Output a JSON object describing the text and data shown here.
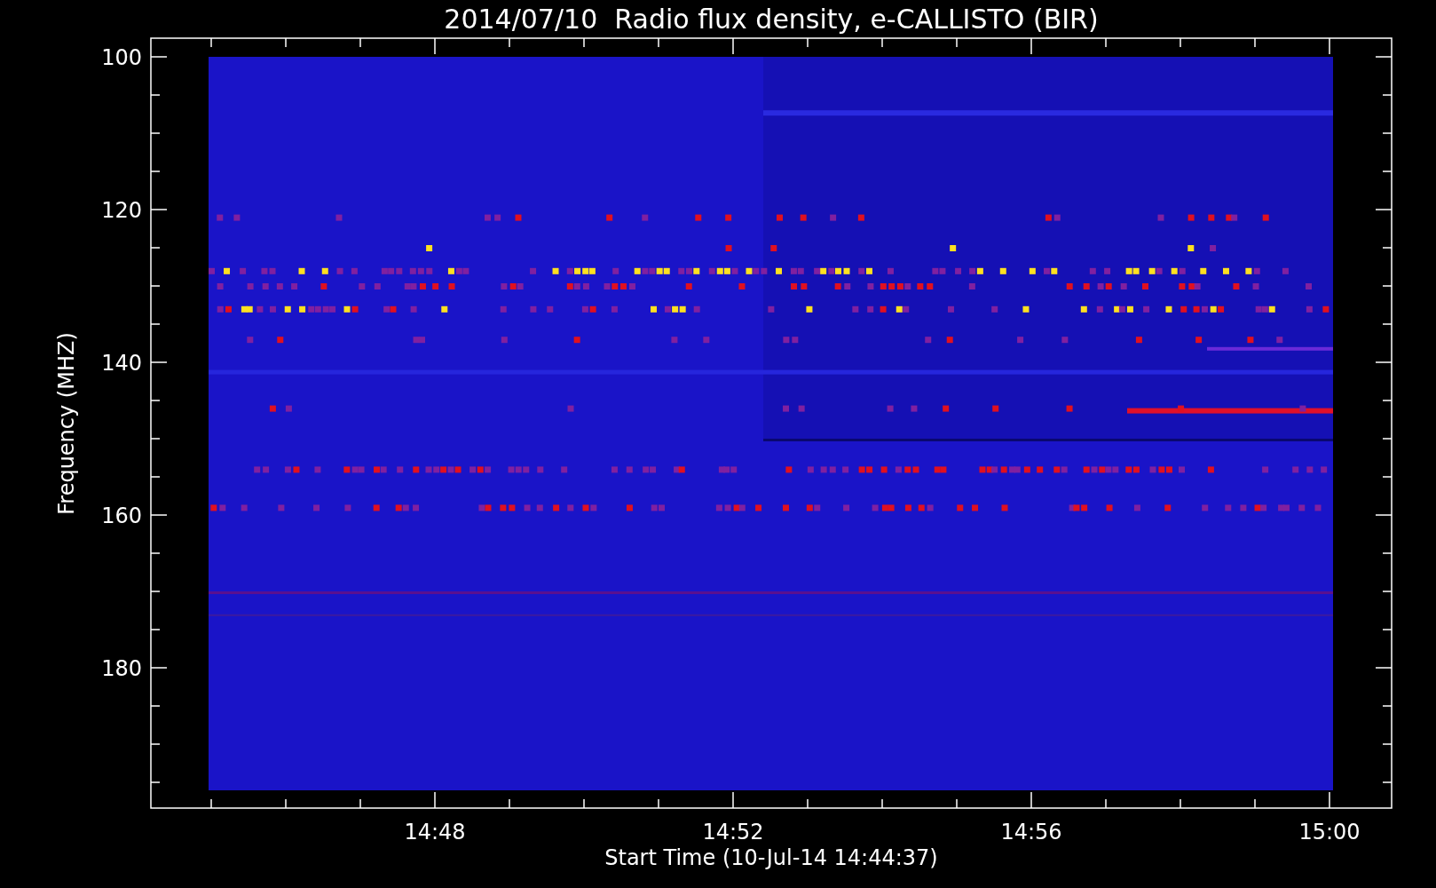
{
  "title": "2014/07/10  Radio flux density, e-CALLISTO (BIR)",
  "y_axis": {
    "label": "Frequency (MHZ)",
    "ticks": [
      "100",
      "120",
      "140",
      "160",
      "180"
    ]
  },
  "x_axis": {
    "label": "Start Time (10-Jul-14 14:44:37)",
    "ticks": [
      "14:48",
      "14:52",
      "14:56",
      "15:00"
    ]
  }
}
